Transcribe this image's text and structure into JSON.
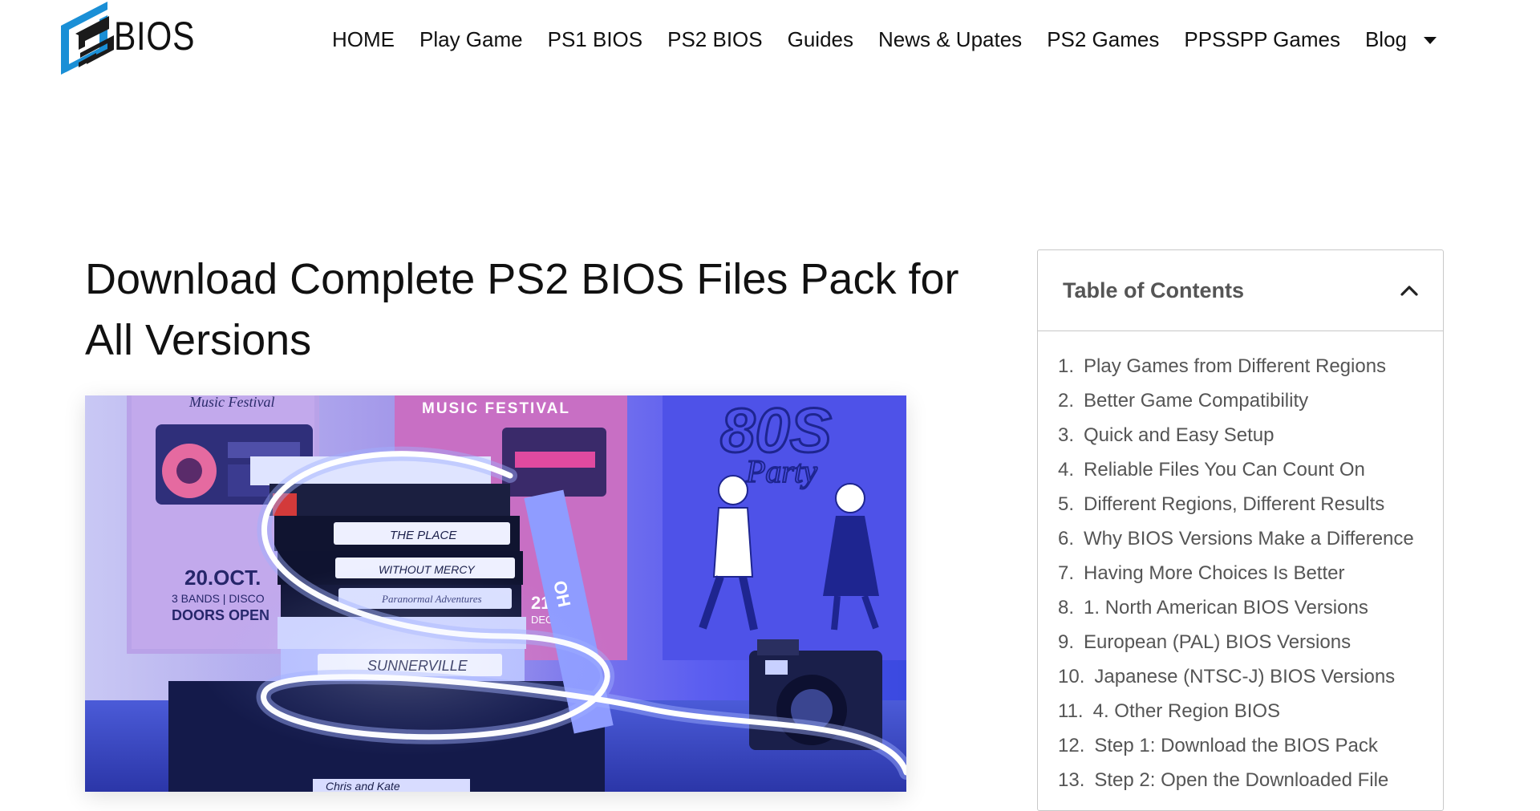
{
  "header": {
    "logo_text": "BIOS",
    "nav": [
      {
        "label": "HOME"
      },
      {
        "label": "Play Game"
      },
      {
        "label": "PS1 BIOS"
      },
      {
        "label": "PS2 BIOS"
      },
      {
        "label": "Guides"
      },
      {
        "label": "News & Upates"
      },
      {
        "label": "PS2 Games"
      },
      {
        "label": "PPSSPP Games"
      },
      {
        "label": "Blog",
        "has_dropdown": true
      }
    ]
  },
  "article": {
    "title": "Download Complete PS2 BIOS Files Pack for All Versions",
    "image": {
      "poster_left_title": "Music Festival",
      "poster_left_date": "20.OCT.",
      "poster_left_line2": "3 BANDS | DISCO",
      "poster_left_line3": "DOORS OPEN",
      "poster_mid_title": "MUSIC FESTIVAL",
      "poster_mid_date": "21",
      "poster_mid_month": "DEC",
      "poster_right_title": "80S",
      "poster_right_sub": "Party",
      "tape_labels": [
        "THE PLACE",
        "WITHOUT MERCY",
        "Paranormal Adventures",
        "SUNNERVILLE",
        "Chris and Kate"
      ],
      "tape_side_label": "OH"
    }
  },
  "toc": {
    "title": "Table of Contents",
    "expanded": true,
    "items": [
      {
        "num": "1.",
        "label": "Play Games from Different Regions"
      },
      {
        "num": "2.",
        "label": "Better Game Compatibility"
      },
      {
        "num": "3.",
        "label": "Quick and Easy Setup"
      },
      {
        "num": "4.",
        "label": "Reliable Files You Can Count On"
      },
      {
        "num": "5.",
        "label": "Different Regions, Different Results"
      },
      {
        "num": "6.",
        "label": "Why BIOS Versions Make a Difference"
      },
      {
        "num": "7.",
        "label": "Having More Choices Is Better"
      },
      {
        "num": "8.",
        "label": "1. North American BIOS Versions"
      },
      {
        "num": "9.",
        "label": "European (PAL) BIOS Versions"
      },
      {
        "num": "10.",
        "label": "Japanese (NTSC-J) BIOS Versions"
      },
      {
        "num": "11.",
        "label": "4. Other Region BIOS"
      },
      {
        "num": "12.",
        "label": "Step 1: Download the BIOS Pack"
      },
      {
        "num": "13.",
        "label": "Step 2: Open the Downloaded File"
      }
    ]
  },
  "colors": {
    "logo_blue": "#1a8fd6",
    "logo_dark": "#1b1b1b",
    "text": "#111111",
    "toc_text": "#555555",
    "toc_border": "#c8c8c8"
  }
}
